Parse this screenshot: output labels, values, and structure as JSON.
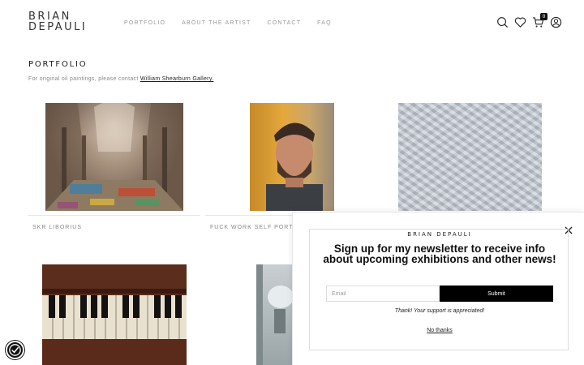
{
  "header": {
    "logo_line1": "BRIAN",
    "logo_line2": "DEPAULI",
    "nav": [
      "PORTFOLIO",
      "ABOUT THE ARTIST",
      "CONTACT",
      "FAQ"
    ],
    "cart_count": "0"
  },
  "portfolio": {
    "title": "PORTFOLIO",
    "intro_text": "For original oil paintings, please contact ",
    "intro_link": "William Shearburn Gallery.",
    "items": [
      {
        "caption": "SKR LIBORIUS"
      },
      {
        "caption": "FUCK WORK SELF PORTRAIT"
      },
      {
        "caption": ""
      },
      {
        "caption": ""
      },
      {
        "caption": ""
      }
    ]
  },
  "popup": {
    "brand": "BRIAN DEPAULI",
    "heading": "Sign up for my newsletter to receive info about upcoming exhibitions and other news!",
    "email_placeholder": "Email",
    "submit_label": "Submit",
    "thanks_text": "Thank! Your support is appreciated!",
    "no_thanks": "No thanks"
  },
  "icons": {
    "search": "search-icon",
    "wishlist": "heart-icon",
    "cart": "cart-icon",
    "account": "user-icon",
    "close": "close-icon",
    "accessibility": "accessibility-icon"
  }
}
